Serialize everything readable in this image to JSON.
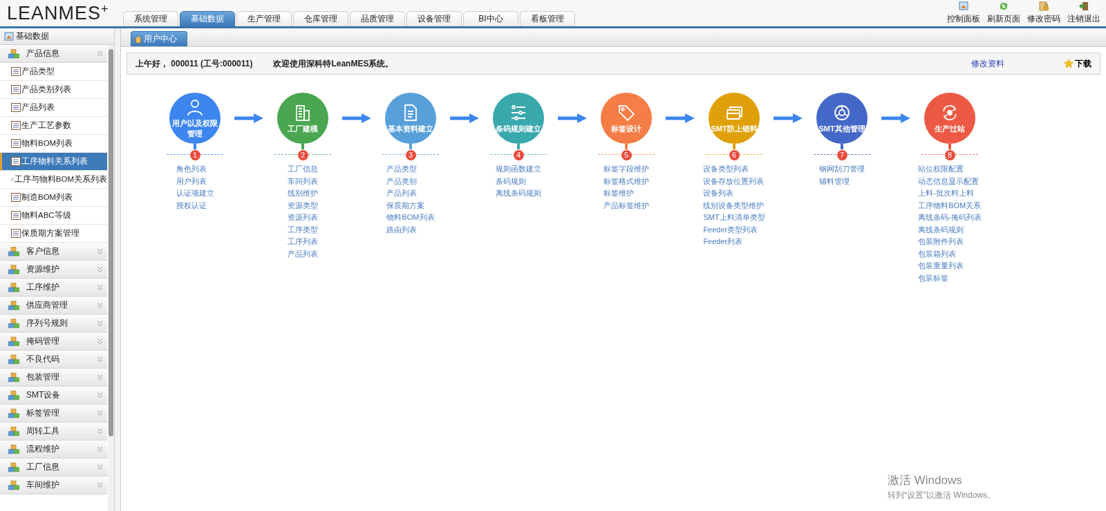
{
  "header": {
    "logo": "LEANMES",
    "logo_mark": "+",
    "tabs": [
      {
        "label": "系统管理",
        "selected": false
      },
      {
        "label": "基础数据",
        "selected": true
      },
      {
        "label": "生产管理",
        "selected": false
      },
      {
        "label": "仓库管理",
        "selected": false
      },
      {
        "label": "品质管理",
        "selected": false
      },
      {
        "label": "设备管理",
        "selected": false
      },
      {
        "label": "BI中心",
        "selected": false
      },
      {
        "label": "看板管理",
        "selected": false
      }
    ],
    "tools": [
      "控制面板",
      "刷新页面",
      "修改密码",
      "注销退出"
    ]
  },
  "sidebar": {
    "title": "基础数据",
    "groups": [
      {
        "label": "产品信息",
        "expanded": true,
        "items": [
          {
            "label": "产品类型",
            "selected": false
          },
          {
            "label": "产品类别列表",
            "selected": false
          },
          {
            "label": "产品列表",
            "selected": false
          },
          {
            "label": "生产工艺参数",
            "selected": false
          },
          {
            "label": "物料BOM列表",
            "selected": false
          },
          {
            "label": "工序物料关系列表",
            "selected": true
          },
          {
            "label": "工序与物料BOM关系列表",
            "selected": false
          },
          {
            "label": "制造BOM列表",
            "selected": false
          },
          {
            "label": "物料ABC等级",
            "selected": false
          },
          {
            "label": "保质期方案管理",
            "selected": false
          }
        ]
      },
      {
        "label": "客户信息",
        "expanded": false
      },
      {
        "label": "资源维护",
        "expanded": false
      },
      {
        "label": "工序维护",
        "expanded": false
      },
      {
        "label": "供应商管理",
        "expanded": false
      },
      {
        "label": "序列号规则",
        "expanded": false
      },
      {
        "label": "掩码管理",
        "expanded": false
      },
      {
        "label": "不良代码",
        "expanded": false
      },
      {
        "label": "包装管理",
        "expanded": false
      },
      {
        "label": "SMT设备",
        "expanded": false
      },
      {
        "label": "标签管理",
        "expanded": false
      },
      {
        "label": "周转工具",
        "expanded": false
      },
      {
        "label": "流程维护",
        "expanded": false
      },
      {
        "label": "工厂信息",
        "expanded": false
      },
      {
        "label": "车间维护",
        "expanded": false
      }
    ]
  },
  "page_tabs": [
    {
      "label": "用户中心",
      "selected": true
    }
  ],
  "welcome": {
    "greeting": "上午好， 000011 (工号:000011)",
    "message": "欢迎使用深科特LeanMES系统。",
    "edit_link": "修改资料",
    "download": "下载"
  },
  "steps": [
    {
      "title": "用户以及权限管理",
      "number": "1",
      "color": "#3d86f0",
      "links": [
        "角色列表",
        "用户列表",
        "认证项建立",
        "授权认证"
      ]
    },
    {
      "title": "工厂建模",
      "number": "2",
      "color": "#4aa650",
      "links": [
        "工厂信息",
        "车间列表",
        "线别维护",
        "资源类型",
        "资源列表",
        "工序类型",
        "工序列表",
        "产品列表"
      ]
    },
    {
      "title": "基本资料建立",
      "number": "3",
      "color": "#58a0da",
      "links": [
        "产品类型",
        "产品类别",
        "产品列表",
        "保质期方案",
        "物料BOM列表",
        "路由列表"
      ]
    },
    {
      "title": "条码规则建立",
      "number": "4",
      "color": "#3aa9ad",
      "links": [
        "规则函数建立",
        "条码规则",
        "离线条码规则"
      ]
    },
    {
      "title": "标签设计",
      "number": "5",
      "color": "#f57d46",
      "links": [
        "标签字段维护",
        "标签格式维护",
        "标签维护",
        "产品标签维护"
      ]
    },
    {
      "title": "SMT防上错料",
      "number": "6",
      "color": "#e0a00b",
      "links": [
        "设备类型列表",
        "设备存放位置列表",
        "设备列表",
        "线别设备类型维护",
        "SMT上料清单类型",
        "Feeder类型列表",
        "Feeder列表"
      ]
    },
    {
      "title": "SMT其他管理",
      "number": "7",
      "color": "#4468c8",
      "links": [
        "钢网刮刀管理",
        "辅料管理"
      ]
    },
    {
      "title": "生产过站",
      "number": "8",
      "color": "#ec5a45",
      "links": [
        "站位权限配置",
        "动态信息显示配置",
        "上料-批次料上料",
        "工序物料BOM关系",
        "离线条码-掩码列表",
        "离线条码规则",
        "包装附件列表",
        "包装箱列表",
        "包装重量列表",
        "包装标签"
      ]
    }
  ],
  "activation_notice": {
    "title": "激活 Windows",
    "hint": "转到“设置”以激活 Windows。"
  }
}
